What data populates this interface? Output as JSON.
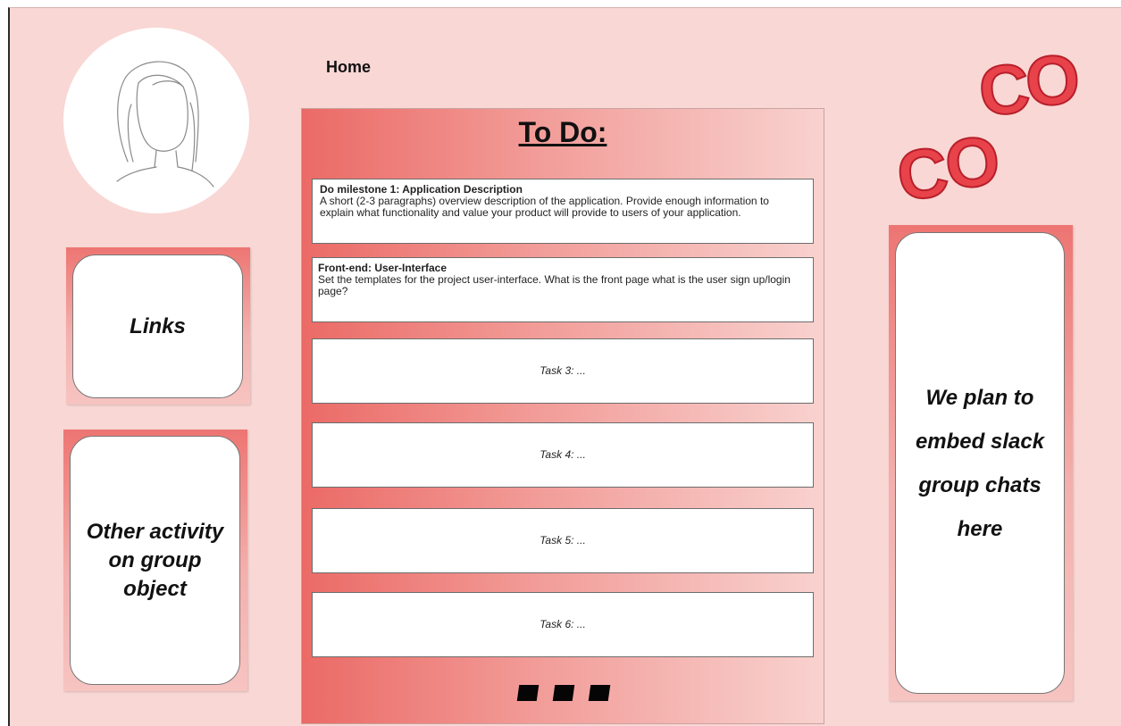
{
  "nav": {
    "home_label": "Home"
  },
  "logo": {
    "text": "COCO",
    "color": "#e8424a"
  },
  "sidebar": {
    "links_label": "Links",
    "activity_label": "Other activity on group object"
  },
  "todo": {
    "title": "To Do:",
    "tasks": [
      {
        "title": "Do milestone 1: Application Description",
        "description": "A short (2-3 paragraphs) overview description of the application. Provide enough information to explain what functionality and value your product will provide to users of your application."
      },
      {
        "title": "Front-end: User-Interface",
        "description": "Set the templates for the project user-interface. What is the front page what is the user sign up/login page?"
      },
      {
        "label": "Task 3: ..."
      },
      {
        "label": "Task 4: ..."
      },
      {
        "label": "Task 5: ..."
      },
      {
        "label": "Task 6: ..."
      }
    ]
  },
  "chat": {
    "placeholder_text": "We plan to embed slack group chats here"
  },
  "colors": {
    "background": "#f9d7d4",
    "accent": "#ed7572"
  }
}
